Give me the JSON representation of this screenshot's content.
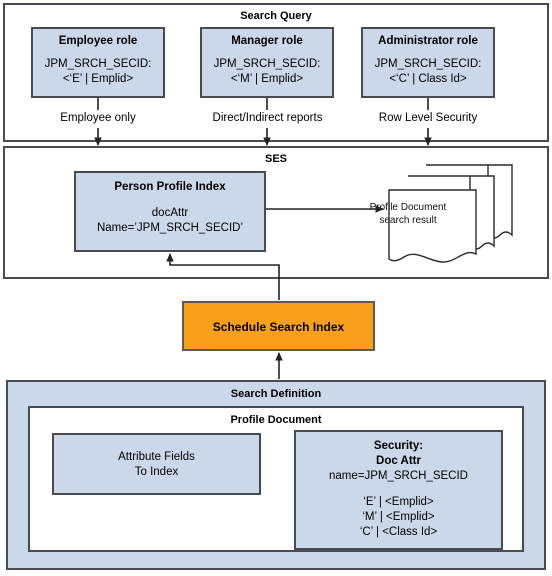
{
  "diagram": {
    "colors": {
      "box_fill_blue": "#cbd8ea",
      "box_fill_orange": "#f9a01b",
      "border": "#4a4a52",
      "background": "#ffffff"
    },
    "search_query": {
      "title": "Search Query",
      "roles": [
        {
          "title": "Employee role",
          "line1": "JPM_SRCH_SECID:",
          "line2": "<‘E’ | Emplid>",
          "edge_label": "Employee only"
        },
        {
          "title": "Manager role",
          "line1": "JPM_SRCH_SECID:",
          "line2": "<‘M’ | Emplid>",
          "edge_label": "Direct/Indirect reports"
        },
        {
          "title": "Administrator role",
          "line1": "JPM_SRCH_SECID:",
          "line2": "<‘C’ | Class Id>",
          "edge_label": "Row Level Security"
        }
      ]
    },
    "ses": {
      "title": "SES",
      "person_profile_index": {
        "title": "Person Profile Index",
        "line1": "docAttr",
        "line2": "Name=’JPM_SRCH_SECID’"
      },
      "search_result_doc": {
        "line1": "Profile Document",
        "line2": "search result"
      }
    },
    "schedule": {
      "label": "Schedule Search Index"
    },
    "search_definition": {
      "title": "Search Definition",
      "profile_document": {
        "title": "Profile Document",
        "attribute_fields": {
          "line1": "Attribute Fields",
          "line2": "To Index"
        },
        "security": {
          "title_line1": "Security:",
          "title_line2": "Doc Attr",
          "name_line": "name=JPM_SRCH_SECID",
          "values": [
            "‘E’ | <Emplid>",
            "‘M’ | <Emplid>",
            "‘C’ | <Class Id>"
          ]
        }
      }
    }
  }
}
